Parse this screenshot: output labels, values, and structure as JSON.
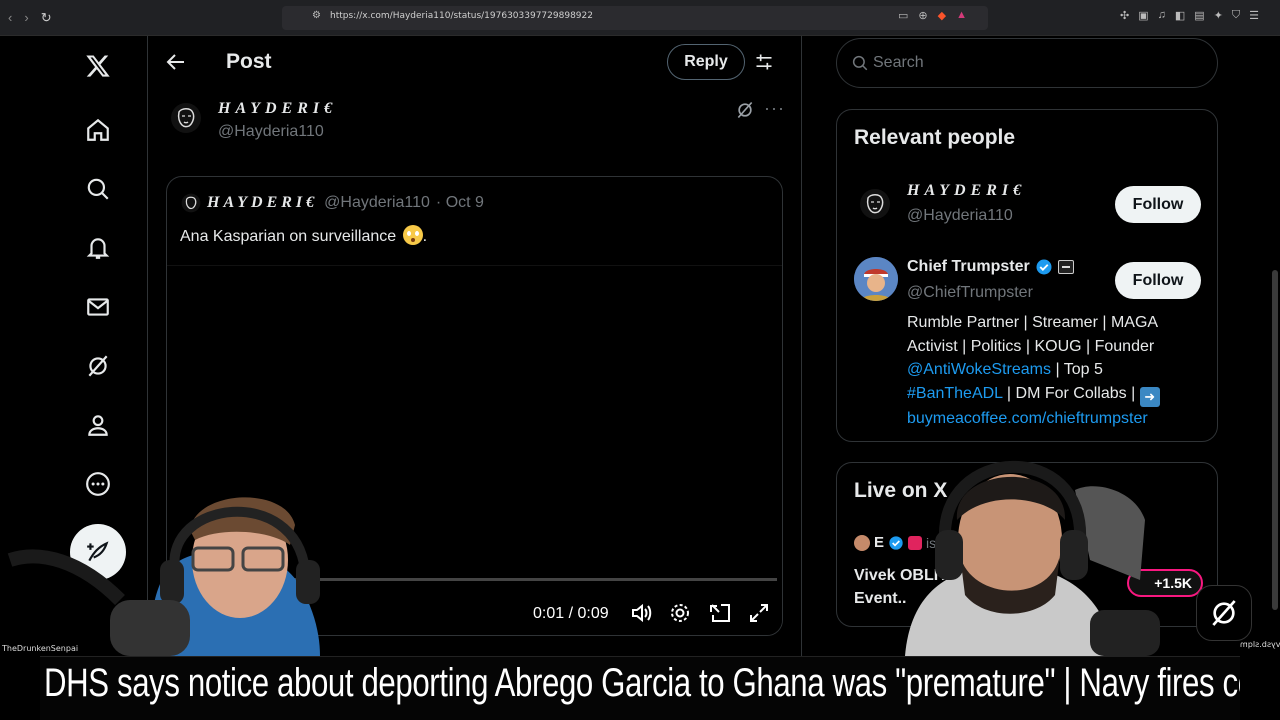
{
  "browser": {
    "url": "https://x.com/Hayderia110/status/1976303397729898922"
  },
  "header": {
    "title": "Post",
    "reply_label": "Reply"
  },
  "post": {
    "author_name": "HAYDERI€",
    "author_handle": "@Hayderia110",
    "quote": {
      "name": "HAYDERI€",
      "handle": "@Hayderia110",
      "date": "· Oct 9",
      "text": "Ana Kasparian on surveillance",
      "text_suffix": "."
    },
    "video": {
      "time": "0:01 / 0:09",
      "progress": 0.11
    }
  },
  "sidebar": {
    "search_placeholder": "Search",
    "relevant_title": "Relevant people",
    "people": [
      {
        "name": "HAYDERI€",
        "handle": "@Hayderia110",
        "follow_label": "Follow"
      },
      {
        "name": "Chief Trumpster",
        "handle": "@ChiefTrumpster",
        "follow_label": "Follow",
        "bio_1": "Rumble Partner | Streamer | MAGA Activist | Politics | KOUG | Founder",
        "bio_mention": "@AntiWokeStreams",
        "bio_2": " | Top 5",
        "bio_hashtag": "#BanTheADL",
        "bio_3": " | DM For Collabs | ",
        "bio_link": "buymeacoffee.com/chieftrumpster"
      }
    ],
    "live": {
      "title": "Live on X",
      "host": "E",
      "is_label": "is",
      "stream_title": "Vivek OBLIT... Event..",
      "count": "+1.5K"
    }
  },
  "overlay": {
    "cam_left_label": "TheDrunkenSenpai",
    "cam_right_label": "vysb.slqm",
    "ticker": "DHS says notice about deporting Abrego Garcia to Ghana was \"premature\"  |  Navy fires commanding officer of U"
  },
  "colors": {
    "accent": "#1d9bf0",
    "live": "#f91880"
  }
}
